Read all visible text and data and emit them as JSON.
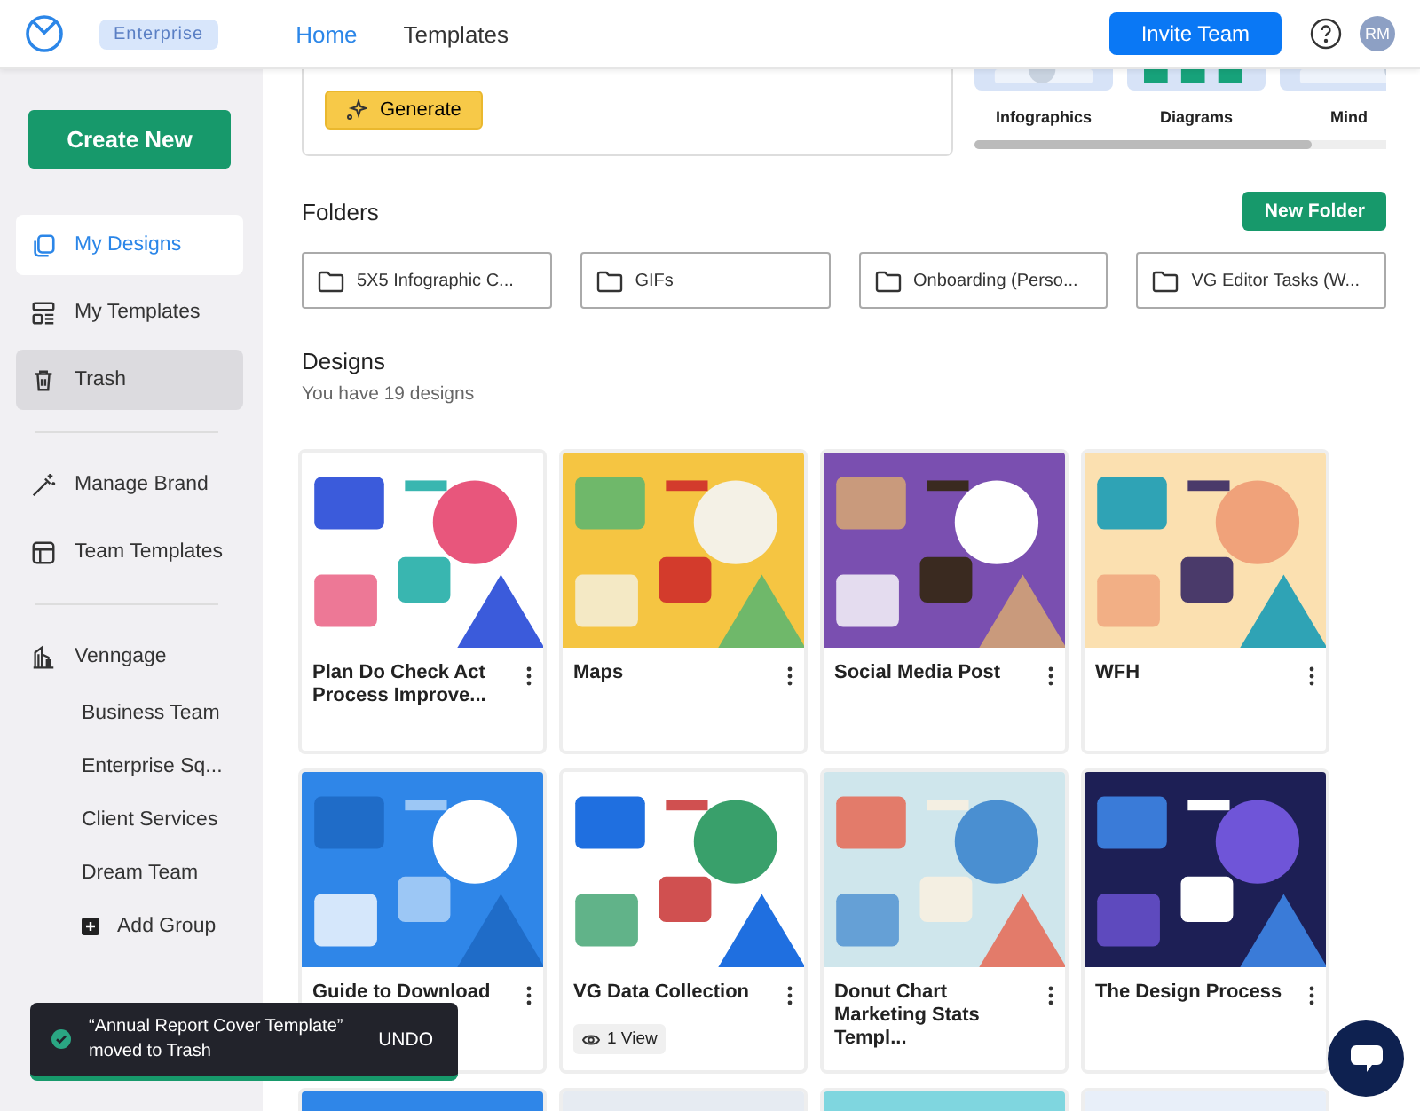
{
  "header": {
    "badge": "Enterprise",
    "nav": [
      {
        "label": "Home",
        "selected": true
      },
      {
        "label": "Templates",
        "selected": false
      }
    ],
    "invite_button": "Invite Team",
    "avatar": "RM"
  },
  "sidebar": {
    "create_button": "Create New",
    "items": [
      {
        "label": "My Designs",
        "selected": true,
        "hovered": false
      },
      {
        "label": "My Templates",
        "selected": false,
        "hovered": false
      },
      {
        "label": "Trash",
        "selected": false,
        "hovered": true
      }
    ],
    "brand_items": [
      {
        "label": "Manage Brand"
      },
      {
        "label": "Team Templates"
      }
    ],
    "team": {
      "label": "Venngage",
      "groups": [
        "Business Team",
        "Enterprise Sq...",
        "Client Services",
        "Dream Team"
      ],
      "add_group": "Add Group"
    }
  },
  "generator": {
    "button": "Generate"
  },
  "template_types": [
    {
      "label": "Infographics"
    },
    {
      "label": "Diagrams"
    },
    {
      "label": "Mind"
    }
  ],
  "folders": {
    "title": "Folders",
    "new_button": "New Folder",
    "items": [
      "5X5 Infographic C...",
      "GIFs",
      "Onboarding (Perso...",
      "VG Editor Tasks (W..."
    ]
  },
  "designs": {
    "title": "Designs",
    "subtitle": "You have 19 designs",
    "cards": [
      {
        "title": "Plan Do Check Act Process Improve...",
        "thumbnail": {
          "kind": "picture"
        }
      },
      {
        "title": "Maps",
        "thumbnail": {
          "kind": "picture"
        }
      },
      {
        "title": "Social Media Post",
        "thumbnail": {
          "kind": "picture"
        }
      },
      {
        "title": "WFH",
        "thumbnail": {
          "kind": "picture"
        }
      },
      {
        "title": "Guide to Download",
        "thumbnail": {
          "kind": "picture"
        }
      },
      {
        "title": "VG Data Collection",
        "views": "1 View",
        "thumbnail": {
          "kind": "picture"
        }
      },
      {
        "title": "Donut Chart Marketing Stats Templ...",
        "thumbnail": {
          "kind": "picture"
        }
      },
      {
        "title": "The Design Process",
        "thumbnail": {
          "kind": "picture"
        }
      },
      {
        "thumbnail": {
          "kind": "picture"
        }
      },
      {
        "thumbnail": {
          "kind": "picture"
        }
      },
      {
        "thumbnail": {
          "kind": "picture"
        }
      },
      {
        "thumbnail": {
          "kind": "picture"
        }
      }
    ]
  },
  "toast": {
    "message": "“Annual Report Cover Template” moved to Trash",
    "action": "UNDO"
  }
}
